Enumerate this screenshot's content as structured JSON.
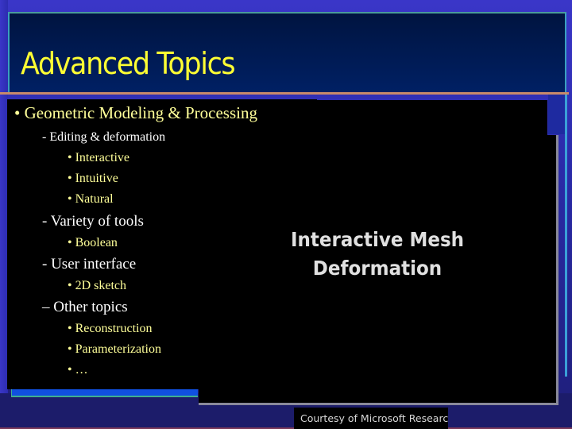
{
  "slide": {
    "title": "Advanced Topics",
    "main_bullet": "• Geometric Modeling & Processing",
    "sections": [
      {
        "heading": "- Editing & deformation",
        "items": [
          "• Interactive",
          "• Intuitive",
          "• Natural"
        ]
      },
      {
        "heading": "- Variety of tools",
        "items": [
          "• Boolean"
        ]
      },
      {
        "heading": "- User interface",
        "items": [
          "•   2D sketch"
        ]
      },
      {
        "heading": "– Other topics",
        "items": [
          "• Reconstruction",
          "• Parameterization",
          "•   …"
        ]
      }
    ]
  },
  "video": {
    "title_line1": "Interactive Mesh",
    "title_line2": "Deformation",
    "credit": "Courtesy of Microsoft Research As"
  },
  "colors": {
    "title": "#ffff33",
    "bullet_text": "#ffff99",
    "subheading_text": "#ffffff",
    "background": "#2a2aa8"
  }
}
